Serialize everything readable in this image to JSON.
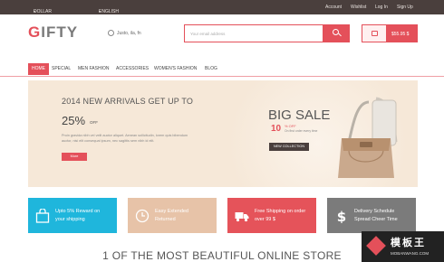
{
  "topbar": {
    "currency": "DOLLAR",
    "language": "ENGLISH",
    "links": [
      "Account",
      "Wishlist",
      "Log In",
      "Sign Up"
    ]
  },
  "header": {
    "logo_first": "G",
    "logo_rest": "IFTY",
    "help_text": "Justo, ila, fn",
    "search_placeholder": "Your email address",
    "cart_price": "$55.95 $"
  },
  "nav": {
    "items": [
      "HOME",
      "SPECIAL",
      "MEN FASHION",
      "ACCESSORIES",
      "WOMEN'S FASHION",
      "BLOG"
    ],
    "active_index": 0
  },
  "banner": {
    "heading": "2014 NEW ARRIVALS GET UP TO",
    "percent": "25%",
    "off": "OFF",
    "text": "Proin gravida nibh vel velit auctor aliquet. Aenean sollicitudin, lorem quis bibendum auctor, nisi elit consequat ipsum, nec sagittis sem nibh id elit.",
    "button": "More",
    "sale_title": "BIG SALE",
    "sale_number": "10",
    "sale_off": "% OFF",
    "sale_sub": "On first order every time",
    "sale_button": "NEW COLLECTION"
  },
  "features": [
    {
      "line1": "Upto 5% Reward on",
      "line2": "your shipping",
      "icon": "shopping-bag-icon",
      "color": "#1fb6dc"
    },
    {
      "line1": "Easy Extended",
      "line2": "Returned",
      "icon": "clock-icon",
      "color": "#e7c3a8"
    },
    {
      "line1": "Free Shipping on order",
      "line2": "over 99 $",
      "icon": "truck-icon",
      "color": "#e5535a"
    },
    {
      "line1": "Delivery Schedule",
      "line2": "Spread Cheer Time",
      "icon": "dollar-icon",
      "color": "#7b7b7b"
    }
  ],
  "tagline": "1 OF THE MOST BEAUTIFUL ONLINE STORE",
  "watermark": {
    "cn": "模板王",
    "en": "MOBANWANG.COM"
  },
  "colors": {
    "accent": "#e4505a",
    "topbar": "#4a3f3d",
    "banner": "#f6e8d8"
  }
}
